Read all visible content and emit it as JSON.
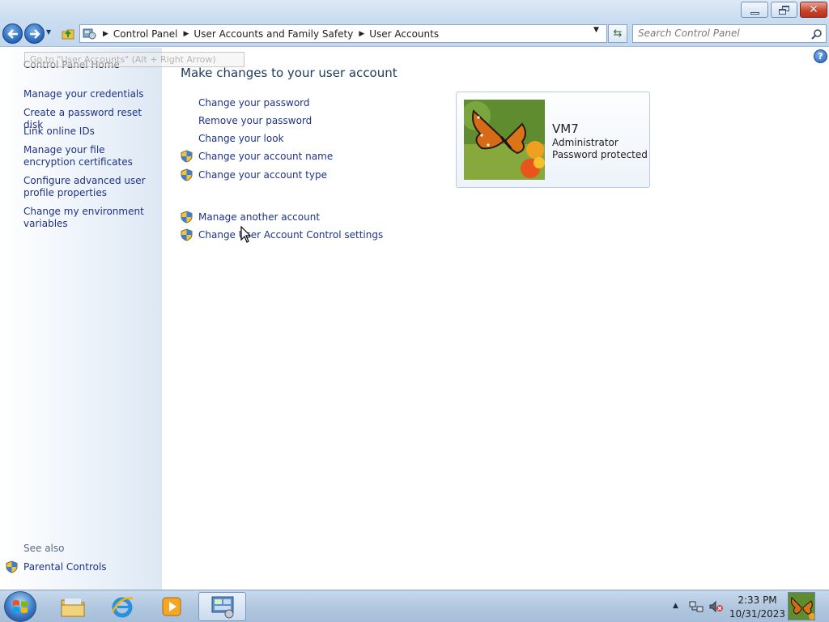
{
  "window": {
    "controls": {
      "minimize": "minimize",
      "maximize": "restore",
      "close": "close"
    }
  },
  "address_bar": {
    "breadcrumbs": [
      "Control Panel",
      "User Accounts and Family Safety",
      "User Accounts"
    ]
  },
  "search": {
    "placeholder": "Search Control Panel"
  },
  "left_pane": {
    "home": "Control Panel Home",
    "tooltip": "Go to \"User Accounts\" (Alt + Right Arrow)",
    "links": [
      "Manage your credentials",
      "Create a password reset disk",
      "Link online IDs",
      "Manage your file encryption certificates",
      "Configure advanced user profile properties",
      "Change my environment variables"
    ],
    "see_also_label": "See also",
    "see_also_links": [
      "Parental Controls"
    ]
  },
  "main": {
    "title": "Make changes to your user account",
    "tasks": [
      "Change your password",
      "Remove your password",
      "Change your look",
      "Change your account name",
      "Change your account type"
    ],
    "other_tasks": [
      "Manage another account",
      "Change User Account Control settings"
    ]
  },
  "user": {
    "name": "VM7",
    "role": "Administrator",
    "status": "Password protected"
  },
  "taskbar": {
    "pinned": [
      "Windows Explorer",
      "Internet Explorer",
      "Windows Media Player",
      "Control Panel"
    ],
    "clock": {
      "time": "2:33 PM",
      "date": "10/31/2023"
    }
  },
  "colors": {
    "link": "#1e3287",
    "title": "#1e395b",
    "chrome": "#c9dcf0"
  }
}
